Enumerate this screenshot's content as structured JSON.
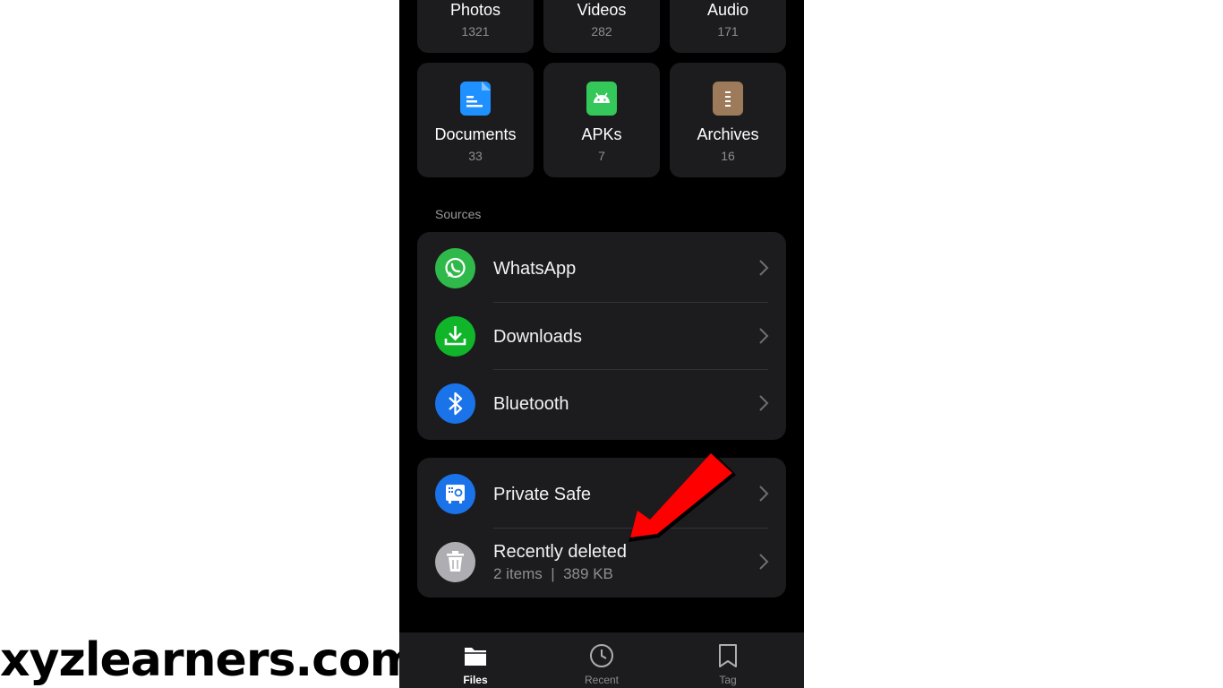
{
  "watermark": "xyzlearners.com",
  "categories": [
    {
      "name": "Photos",
      "count": "1321",
      "icon": "photos-icon"
    },
    {
      "name": "Videos",
      "count": "282",
      "icon": "videos-icon"
    },
    {
      "name": "Audio",
      "count": "171",
      "icon": "audio-icon"
    },
    {
      "name": "Documents",
      "count": "33",
      "icon": "document-icon",
      "color": "#1e90ff"
    },
    {
      "name": "APKs",
      "count": "7",
      "icon": "android-icon",
      "color": "#34c759"
    },
    {
      "name": "Archives",
      "count": "16",
      "icon": "archive-icon",
      "color": "#9c7a5a"
    }
  ],
  "sources_label": "Sources",
  "sources": [
    {
      "label": "WhatsApp",
      "icon": "whatsapp-icon",
      "color": "#2fb94a"
    },
    {
      "label": "Downloads",
      "icon": "download-icon",
      "color": "#10b52a"
    },
    {
      "label": "Bluetooth",
      "icon": "bluetooth-icon",
      "color": "#1a73e8"
    }
  ],
  "others": [
    {
      "label": "Private Safe",
      "icon": "safe-icon",
      "color": "#1a73e8"
    },
    {
      "label": "Recently deleted",
      "sub": "2 items  |  389 KB",
      "icon": "trash-icon",
      "color": "#aeaeb2"
    }
  ],
  "nav": [
    {
      "label": "Files",
      "icon": "folder-icon",
      "active": true
    },
    {
      "label": "Recent",
      "icon": "clock-icon",
      "active": false
    },
    {
      "label": "Tag",
      "icon": "bookmark-icon",
      "active": false
    }
  ],
  "annotation_color": "#ff0000"
}
